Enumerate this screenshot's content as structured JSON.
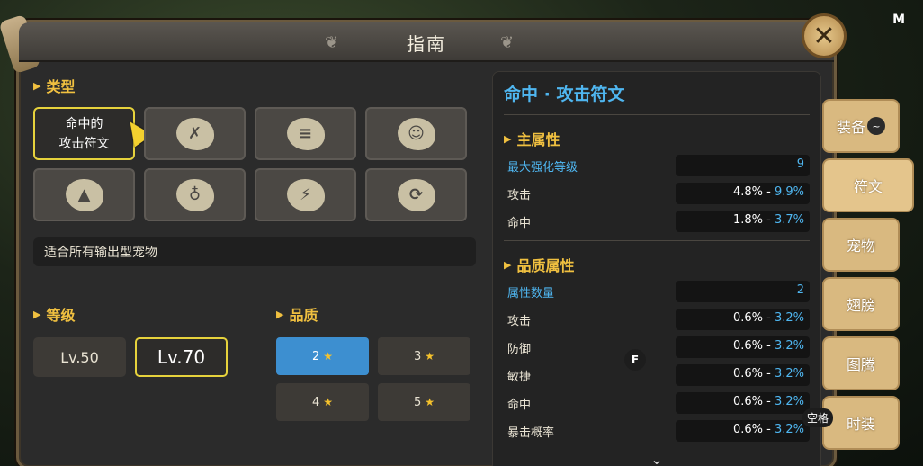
{
  "hotkey_map": "M",
  "window": {
    "title": "指南",
    "close_label": "✕"
  },
  "type_section": {
    "title": "类型",
    "items": [
      {
        "label": "命中的\n攻击符文",
        "selected": true,
        "icon": ""
      },
      {
        "label": "",
        "icon": "✗"
      },
      {
        "label": "",
        "icon": "≡"
      },
      {
        "label": "",
        "icon": "☺"
      },
      {
        "label": "",
        "icon": "▲"
      },
      {
        "label": "",
        "icon": "♁"
      },
      {
        "label": "",
        "icon": "⚡"
      },
      {
        "label": "",
        "icon": "⟳"
      }
    ],
    "description": "适合所有输出型宠物"
  },
  "level_section": {
    "title": "等级",
    "options": [
      {
        "label": "Lv.50"
      },
      {
        "label": "Lv.70",
        "selected": true
      }
    ]
  },
  "quality_section": {
    "title": "品质",
    "options": [
      {
        "label": "2",
        "selected": true
      },
      {
        "label": "3"
      },
      {
        "label": "4"
      },
      {
        "label": "5"
      }
    ]
  },
  "rune_detail": {
    "title": "命中 · 攻击符文",
    "main_attr": {
      "title": "主属性",
      "rows": [
        {
          "name": "最大强化等级",
          "value": "9",
          "blue": true
        },
        {
          "name": "攻击",
          "min": "4.8%",
          "max": "9.9%"
        },
        {
          "name": "命中",
          "min": "1.8%",
          "max": "3.7%"
        }
      ]
    },
    "quality_attr": {
      "title": "品质属性",
      "rows": [
        {
          "name": "属性数量",
          "value": "2",
          "blue": true
        },
        {
          "name": "攻击",
          "min": "0.6%",
          "max": "3.2%"
        },
        {
          "name": "防御",
          "min": "0.6%",
          "max": "3.2%"
        },
        {
          "name": "敏捷",
          "min": "0.6%",
          "max": "3.2%"
        },
        {
          "name": "命中",
          "min": "0.6%",
          "max": "3.2%"
        },
        {
          "name": "暴击概率",
          "min": "0.6%",
          "max": "3.2%"
        }
      ]
    },
    "scroll_indicator": "⌄",
    "range_separator": " - "
  },
  "side_tabs": [
    {
      "label": "装备",
      "key": "~"
    },
    {
      "label": "符文",
      "active": true
    },
    {
      "label": "宠物"
    },
    {
      "label": "翅膀"
    },
    {
      "label": "图腾"
    },
    {
      "label": "时装"
    }
  ],
  "key_hints": {
    "f": "F",
    "space": "空格"
  },
  "colors": {
    "accent_yellow": "#f0c040",
    "accent_blue": "#4fb6f0",
    "selected_border": "#e6d23c",
    "tab_bg": "#d9b980"
  }
}
